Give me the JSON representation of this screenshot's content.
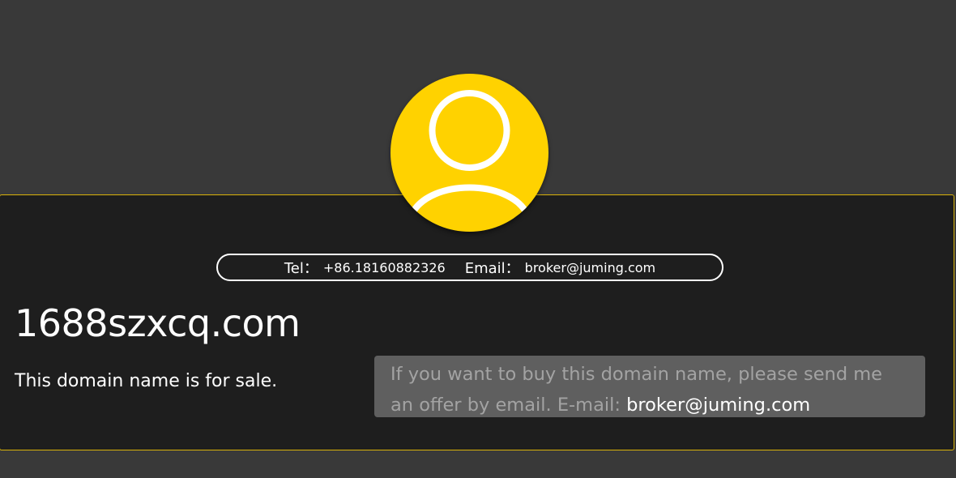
{
  "contact": {
    "tel_label": "Tel：",
    "tel_value": "+86.18160882326",
    "email_label": "Email：",
    "email_value": "broker@juming.com"
  },
  "domain": {
    "name": "1688szxcq.com",
    "sale_text": "This domain name is for sale."
  },
  "offer": {
    "text": "If you want to buy this domain name, please send me an offer by email. E-mail: ",
    "email": "broker@juming.com"
  },
  "colors": {
    "background": "#393939",
    "panel": "#1e1e1e",
    "accent": "#ffd200",
    "panel_border": "#d9b20a",
    "offer_box": "#5f5f5f"
  },
  "icons": {
    "avatar": "user-icon"
  }
}
